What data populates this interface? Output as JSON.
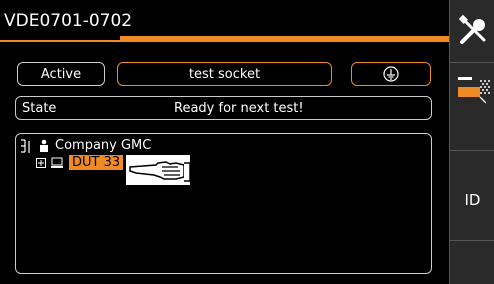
{
  "header": {
    "title": "VDE0701-0702"
  },
  "controls": {
    "active_label": "Active",
    "socket_label": "test socket",
    "ground_icon": "ground-icon"
  },
  "state": {
    "label": "State",
    "value": "Ready for next test!"
  },
  "tree": {
    "root_label": "Company GMC",
    "child_label": "DUT 33"
  },
  "sidebar": {
    "tools_icon": "tools-icon",
    "tree_icon": "tree-view-icon",
    "id_label": "ID"
  },
  "colors": {
    "accent": "#f08a24"
  }
}
